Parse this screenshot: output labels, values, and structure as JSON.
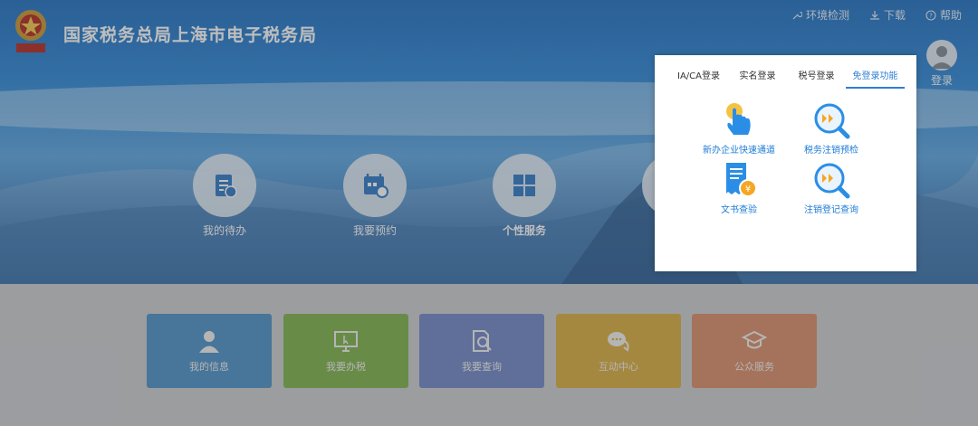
{
  "header": {
    "title": "国家税务总局上海市电子税务局",
    "links": [
      {
        "label": "环境检测",
        "icon": "wrench-icon"
      },
      {
        "label": "下载",
        "icon": "download-icon"
      },
      {
        "label": "帮助",
        "icon": "help-icon"
      }
    ],
    "login_label": "登录"
  },
  "services": [
    {
      "label": "我的待办",
      "icon": "todo-doc-icon"
    },
    {
      "label": "我要预约",
      "icon": "calendar-clock-icon"
    },
    {
      "label": "个性服务",
      "icon": "grid-icon"
    }
  ],
  "login_panel": {
    "tabs": [
      "IA/CA登录",
      "实名登录",
      "税号登录",
      "免登录功能"
    ],
    "active_tab": 3,
    "functions": [
      {
        "label": "新办企业快速通道",
        "icon": "tap-hand-icon"
      },
      {
        "label": "税务注销预检",
        "icon": "search-arrow-icon"
      },
      {
        "label": "文书查验",
        "icon": "receipt-yuan-icon"
      },
      {
        "label": "注销登记查询",
        "icon": "search-arrow-icon"
      }
    ]
  },
  "tiles": [
    {
      "label": "我的信息",
      "icon": "user-icon",
      "color": "#4a90c8"
    },
    {
      "label": "我要办税",
      "icon": "monitor-cursor-icon",
      "color": "#7bb24a"
    },
    {
      "label": "我要查询",
      "icon": "doc-search-icon",
      "color": "#6e86c6"
    },
    {
      "label": "互动中心",
      "icon": "chat-bubbles-icon",
      "color": "#d9ad3e"
    },
    {
      "label": "公众服务",
      "icon": "graduate-icon",
      "color": "#d98c67"
    }
  ],
  "colors": {
    "accent": "#2e7fd2",
    "hero": "#2a86d8"
  }
}
